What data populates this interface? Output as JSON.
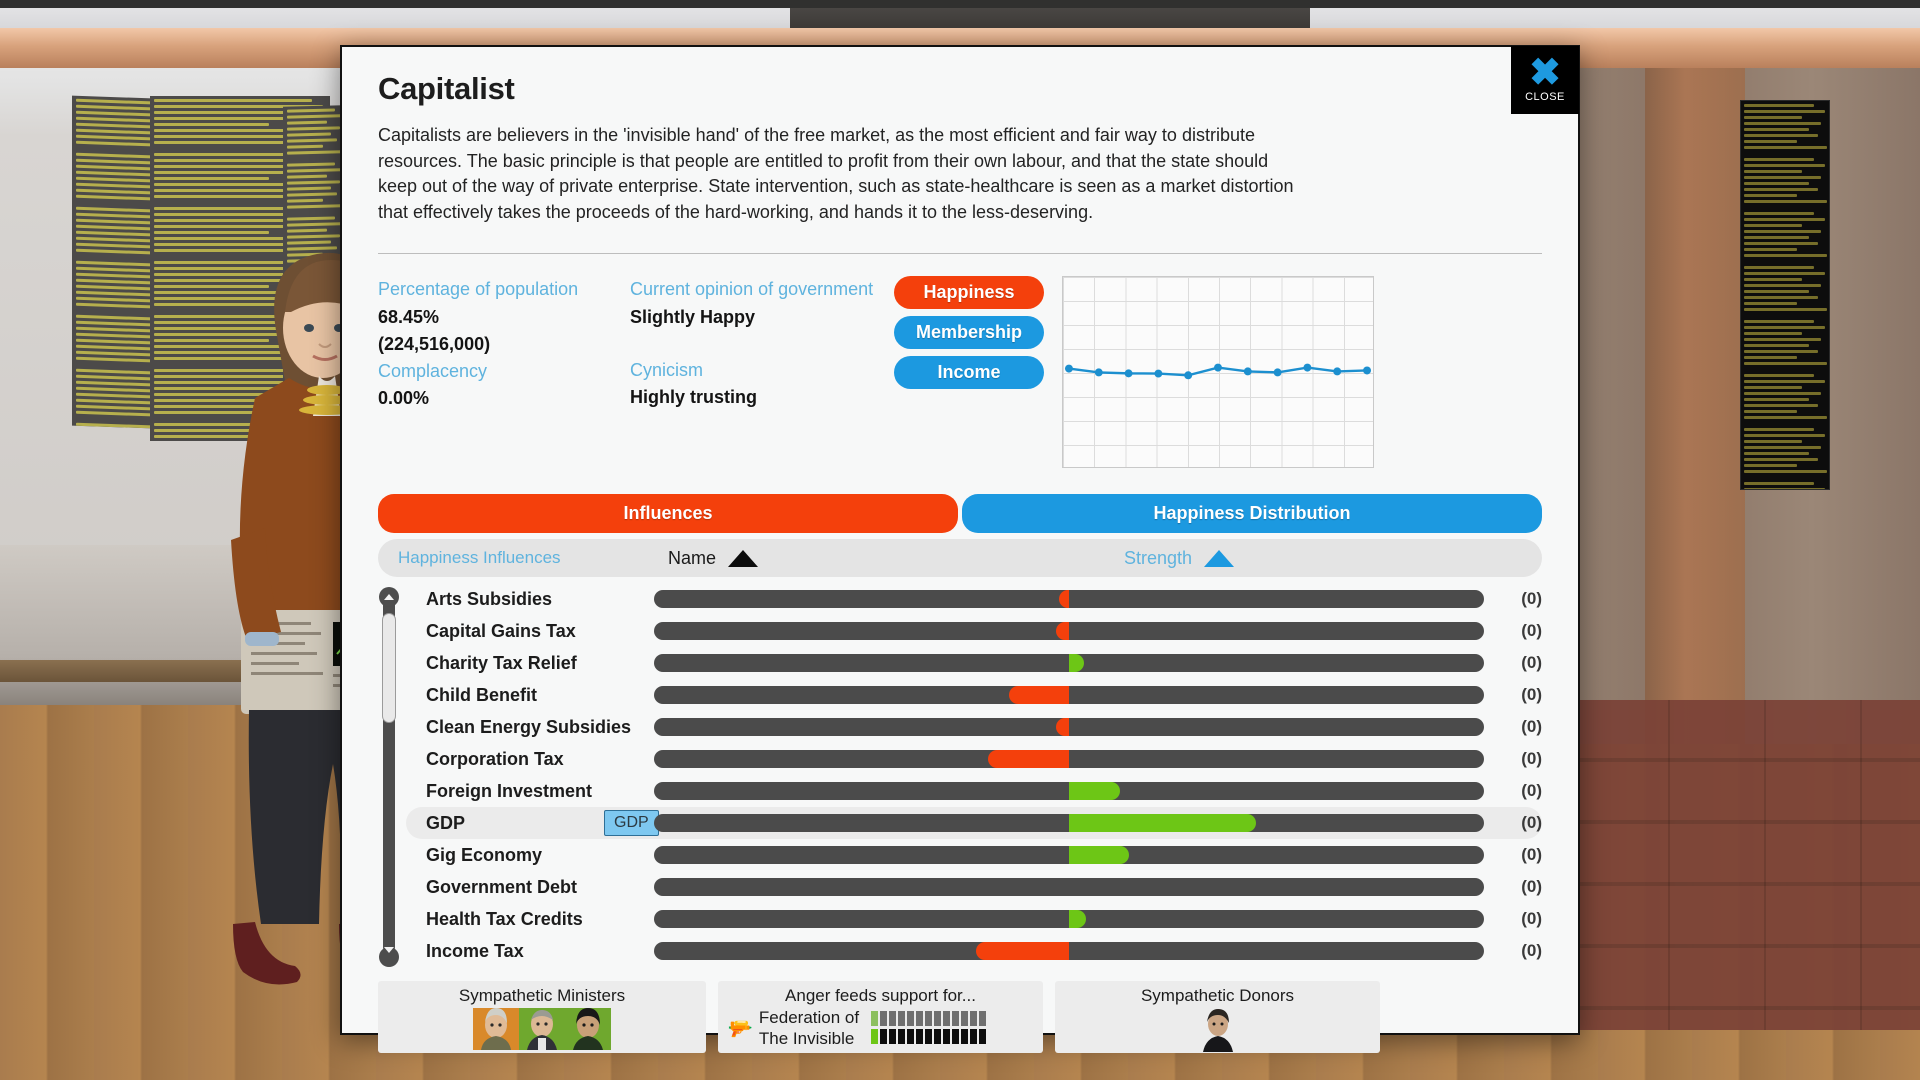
{
  "dialog": {
    "title": "Capitalist",
    "description": "Capitalists are believers in the 'invisible hand' of the free market, as the most efficient and fair way to distribute resources. The basic principle is that people are entitled to profit from their own labour, and that the state should keep out of the way of private enterprise. State intervention, such as state-healthcare is seen as a market distortion that effectively takes the proceeds of the hard-working, and hands it to the less-deserving.",
    "close_label": "CLOSE",
    "close_icon": "close-x-icon"
  },
  "stats": {
    "left": [
      {
        "label": "Percentage of population",
        "value": "68.45%"
      },
      {
        "label": "",
        "value": "(224,516,000)"
      },
      {
        "label": "Complacency",
        "value": "0.00%"
      }
    ],
    "right": [
      {
        "label": "Current opinion of government",
        "value": "Slightly Happy"
      },
      {
        "label": "Cynicism",
        "value": "Highly trusting"
      }
    ]
  },
  "graph_buttons": [
    {
      "label": "Happiness",
      "color": "#f4400c",
      "active": true
    },
    {
      "label": "Membership",
      "color": "#1c99e0",
      "active": false
    },
    {
      "label": "Income",
      "color": "#1c99e0",
      "active": false
    }
  ],
  "chart_data": {
    "type": "line",
    "title": "",
    "xlabel": "",
    "ylabel": "",
    "series": [
      {
        "name": "Happiness",
        "color": "#1c8fcf",
        "x": [
          0,
          1,
          2,
          3,
          4,
          5,
          6,
          7,
          8,
          9,
          10
        ],
        "values": [
          0.52,
          0.5,
          0.495,
          0.494,
          0.485,
          0.525,
          0.505,
          0.5,
          0.525,
          0.505,
          0.51
        ]
      }
    ],
    "ylim": [
      0,
      1
    ],
    "grid": true,
    "legend": "none"
  },
  "tabs": [
    {
      "label": "Influences",
      "active": true
    },
    {
      "label": "Happiness Distribution",
      "active": false
    }
  ],
  "sortbar": {
    "title": "Happiness Influences",
    "name_label": "Name",
    "name_sort_icon": "triangle-up-icon",
    "strength_label": "Strength",
    "strength_sort_icon": "triangle-up-icon"
  },
  "scrollbar": {
    "up_icon": "chevron-up-icon",
    "down_icon": "chevron-down-icon"
  },
  "influences": [
    {
      "name": "Arts Subsidies",
      "strength": -0.012,
      "count": "(0)",
      "highlight": false,
      "tooltip": null
    },
    {
      "name": "Capital Gains Tax",
      "strength": -0.016,
      "count": "(0)",
      "highlight": false,
      "tooltip": null
    },
    {
      "name": "Charity Tax Relief",
      "strength": 0.018,
      "count": "(0)",
      "highlight": false,
      "tooltip": null
    },
    {
      "name": "Child Benefit",
      "strength": -0.072,
      "count": "(0)",
      "highlight": false,
      "tooltip": null
    },
    {
      "name": "Clean Energy Subsidies",
      "strength": -0.016,
      "count": "(0)",
      "highlight": false,
      "tooltip": null
    },
    {
      "name": "Corporation Tax",
      "strength": -0.098,
      "count": "(0)",
      "highlight": false,
      "tooltip": null
    },
    {
      "name": "Foreign Investment",
      "strength": 0.062,
      "count": "(0)",
      "highlight": false,
      "tooltip": null
    },
    {
      "name": "GDP",
      "strength": 0.225,
      "count": "(0)",
      "highlight": true,
      "tooltip": "GDP"
    },
    {
      "name": "Gig Economy",
      "strength": 0.072,
      "count": "(0)",
      "highlight": false,
      "tooltip": null
    },
    {
      "name": "Government Debt",
      "strength": 0.0,
      "count": "(0)",
      "highlight": false,
      "tooltip": null
    },
    {
      "name": "Health Tax Credits",
      "strength": 0.02,
      "count": "(0)",
      "highlight": false,
      "tooltip": null
    },
    {
      "name": "Income Tax",
      "strength": -0.112,
      "count": "(0)",
      "highlight": false,
      "tooltip": null
    }
  ],
  "colors": {
    "positive": "#6dc616",
    "negative": "#f4400c",
    "accent_blue": "#1c99e0",
    "label_blue": "#5fb3de",
    "bar_track": "#4b4b4b"
  },
  "bottom_panels": {
    "ministers": {
      "title": "Sympathetic Ministers",
      "face_count": 3
    },
    "anger": {
      "title": "Anger feeds support for...",
      "icon": "pistol-icon",
      "groups": [
        {
          "name": "Federation of",
          "segments": 13,
          "filled": 1,
          "fill_color": "#8cbf5e",
          "rest_color": "#6f6f6f"
        },
        {
          "name": "The Invisible",
          "segments": 13,
          "filled": 1,
          "fill_color": "#6dc616",
          "rest_color": "#0d0d0d"
        }
      ]
    },
    "donors": {
      "title": "Sympathetic Donors",
      "face_count": 1
    }
  }
}
